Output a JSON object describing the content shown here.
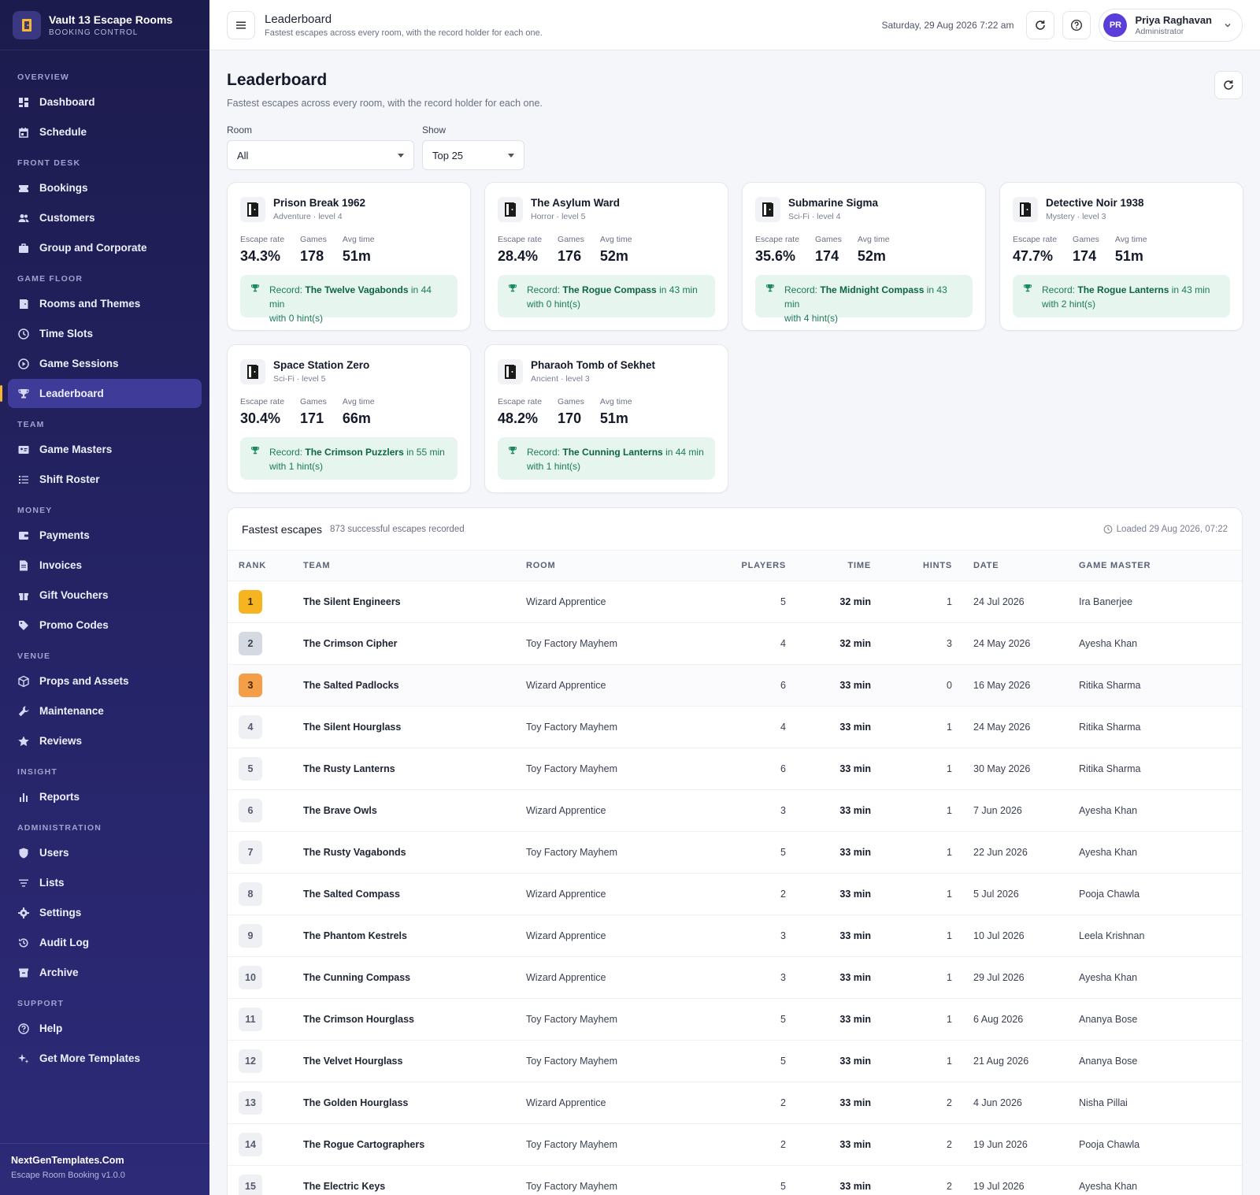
{
  "brand": {
    "name": "Vault 13 Escape Rooms",
    "sub": "BOOKING CONTROL"
  },
  "nav": [
    {
      "section": "OVERVIEW",
      "items": [
        {
          "label": "Dashboard",
          "icon": "dashboard-icon"
        },
        {
          "label": "Schedule",
          "icon": "calendar-icon"
        }
      ]
    },
    {
      "section": "FRONT DESK",
      "items": [
        {
          "label": "Bookings",
          "icon": "ticket-icon"
        },
        {
          "label": "Customers",
          "icon": "users-icon"
        },
        {
          "label": "Group and Corporate",
          "icon": "briefcase-icon"
        }
      ]
    },
    {
      "section": "GAME FLOOR",
      "items": [
        {
          "label": "Rooms and Themes",
          "icon": "door-icon"
        },
        {
          "label": "Time Slots",
          "icon": "clock-icon"
        },
        {
          "label": "Game Sessions",
          "icon": "play-icon"
        },
        {
          "label": "Leaderboard",
          "icon": "trophy-icon",
          "active": true
        }
      ]
    },
    {
      "section": "TEAM",
      "items": [
        {
          "label": "Game Masters",
          "icon": "id-card-icon"
        },
        {
          "label": "Shift Roster",
          "icon": "list-icon"
        }
      ]
    },
    {
      "section": "MONEY",
      "items": [
        {
          "label": "Payments",
          "icon": "wallet-icon"
        },
        {
          "label": "Invoices",
          "icon": "invoice-icon"
        },
        {
          "label": "Gift Vouchers",
          "icon": "gift-icon"
        },
        {
          "label": "Promo Codes",
          "icon": "tag-icon"
        }
      ]
    },
    {
      "section": "VENUE",
      "items": [
        {
          "label": "Props and Assets",
          "icon": "box-icon"
        },
        {
          "label": "Maintenance",
          "icon": "wrench-icon"
        },
        {
          "label": "Reviews",
          "icon": "star-icon"
        }
      ]
    },
    {
      "section": "INSIGHT",
      "items": [
        {
          "label": "Reports",
          "icon": "bar-chart-icon"
        }
      ]
    },
    {
      "section": "ADMINISTRATION",
      "items": [
        {
          "label": "Users",
          "icon": "shield-icon"
        },
        {
          "label": "Lists",
          "icon": "filter-icon"
        },
        {
          "label": "Settings",
          "icon": "gear-icon"
        },
        {
          "label": "Audit Log",
          "icon": "history-icon"
        },
        {
          "label": "Archive",
          "icon": "archive-icon"
        }
      ]
    },
    {
      "section": "SUPPORT",
      "items": [
        {
          "label": "Help",
          "icon": "help-icon"
        },
        {
          "label": "Get More Templates",
          "icon": "sparkle-icon"
        }
      ]
    }
  ],
  "footer": {
    "title": "NextGenTemplates.Com",
    "sub": "Escape Room Booking v1.0.0"
  },
  "topbar": {
    "title": "Leaderboard",
    "subtitle": "Fastest escapes across every room, with the record holder for each one.",
    "date": "Saturday, 29 Aug 2026 7:22 am",
    "user": {
      "initials": "PR",
      "name": "Priya Raghavan",
      "role": "Administrator"
    }
  },
  "page": {
    "title": "Leaderboard",
    "subtitle": "Fastest escapes across every room, with the record holder for each one.",
    "filters": {
      "room": {
        "label": "Room",
        "value": "All"
      },
      "show": {
        "label": "Show",
        "value": "Top 25"
      }
    }
  },
  "stat_labels": {
    "escape_rate": "Escape rate",
    "games": "Games",
    "avg_time": "Avg time",
    "record_prefix": "Record:",
    "in": "in",
    "with": "with"
  },
  "rooms": [
    {
      "name": "Prison Break 1962",
      "meta": "Adventure · level 4",
      "escape_rate": "34.3%",
      "games": "178",
      "avg_time": "51m",
      "record_team": "The Twelve Vagabonds",
      "record_time": "44 min",
      "record_hints": "0 hint(s)"
    },
    {
      "name": "The Asylum Ward",
      "meta": "Horror · level 5",
      "escape_rate": "28.4%",
      "games": "176",
      "avg_time": "52m",
      "record_team": "The Rogue Compass",
      "record_time": "43 min",
      "record_hints": "0 hint(s)"
    },
    {
      "name": "Submarine Sigma",
      "meta": "Sci-Fi · level 4",
      "escape_rate": "35.6%",
      "games": "174",
      "avg_time": "52m",
      "record_team": "The Midnight Compass",
      "record_time": "43 min",
      "record_hints": "4 hint(s)"
    },
    {
      "name": "Detective Noir 1938",
      "meta": "Mystery · level 3",
      "escape_rate": "47.7%",
      "games": "174",
      "avg_time": "51m",
      "record_team": "The Rogue Lanterns",
      "record_time": "43 min",
      "record_hints": "2 hint(s)"
    },
    {
      "name": "Space Station Zero",
      "meta": "Sci-Fi · level 5",
      "escape_rate": "30.4%",
      "games": "171",
      "avg_time": "66m",
      "record_team": "The Crimson Puzzlers",
      "record_time": "55 min",
      "record_hints": "1 hint(s)"
    },
    {
      "name": "Pharaoh Tomb of Sekhet",
      "meta": "Ancient · level 3",
      "escape_rate": "48.2%",
      "games": "170",
      "avg_time": "51m",
      "record_team": "The Cunning Lanterns",
      "record_time": "44 min",
      "record_hints": "1 hint(s)"
    }
  ],
  "table": {
    "title": "Fastest escapes",
    "count": "873 successful escapes recorded",
    "loaded": "Loaded 29 Aug 2026, 07:22",
    "columns": [
      "RANK",
      "TEAM",
      "ROOM",
      "PLAYERS",
      "TIME",
      "HINTS",
      "DATE",
      "GAME MASTER"
    ],
    "rows": [
      {
        "rank": "1",
        "team": "The Silent Engineers",
        "room": "Wizard Apprentice",
        "players": "5",
        "time": "32 min",
        "hints": "1",
        "date": "24 Jul 2026",
        "gm": "Ira Banerjee"
      },
      {
        "rank": "2",
        "team": "The Crimson Cipher",
        "room": "Toy Factory Mayhem",
        "players": "4",
        "time": "32 min",
        "hints": "3",
        "date": "24 May 2026",
        "gm": "Ayesha Khan"
      },
      {
        "rank": "3",
        "team": "The Salted Padlocks",
        "room": "Wizard Apprentice",
        "players": "6",
        "time": "33 min",
        "hints": "0",
        "date": "16 May 2026",
        "gm": "Ritika Sharma"
      },
      {
        "rank": "4",
        "team": "The Silent Hourglass",
        "room": "Toy Factory Mayhem",
        "players": "4",
        "time": "33 min",
        "hints": "1",
        "date": "24 May 2026",
        "gm": "Ritika Sharma"
      },
      {
        "rank": "5",
        "team": "The Rusty Lanterns",
        "room": "Toy Factory Mayhem",
        "players": "6",
        "time": "33 min",
        "hints": "1",
        "date": "30 May 2026",
        "gm": "Ritika Sharma"
      },
      {
        "rank": "6",
        "team": "The Brave Owls",
        "room": "Wizard Apprentice",
        "players": "3",
        "time": "33 min",
        "hints": "1",
        "date": "7 Jun 2026",
        "gm": "Ayesha Khan"
      },
      {
        "rank": "7",
        "team": "The Rusty Vagabonds",
        "room": "Toy Factory Mayhem",
        "players": "5",
        "time": "33 min",
        "hints": "1",
        "date": "22 Jun 2026",
        "gm": "Ayesha Khan"
      },
      {
        "rank": "8",
        "team": "The Salted Compass",
        "room": "Wizard Apprentice",
        "players": "2",
        "time": "33 min",
        "hints": "1",
        "date": "5 Jul 2026",
        "gm": "Pooja Chawla"
      },
      {
        "rank": "9",
        "team": "The Phantom Kestrels",
        "room": "Wizard Apprentice",
        "players": "3",
        "time": "33 min",
        "hints": "1",
        "date": "10 Jul 2026",
        "gm": "Leela Krishnan"
      },
      {
        "rank": "10",
        "team": "The Cunning Compass",
        "room": "Wizard Apprentice",
        "players": "3",
        "time": "33 min",
        "hints": "1",
        "date": "29 Jul 2026",
        "gm": "Ayesha Khan"
      },
      {
        "rank": "11",
        "team": "The Crimson Hourglass",
        "room": "Toy Factory Mayhem",
        "players": "5",
        "time": "33 min",
        "hints": "1",
        "date": "6 Aug 2026",
        "gm": "Ananya Bose"
      },
      {
        "rank": "12",
        "team": "The Velvet Hourglass",
        "room": "Toy Factory Mayhem",
        "players": "5",
        "time": "33 min",
        "hints": "1",
        "date": "21 Aug 2026",
        "gm": "Ananya Bose"
      },
      {
        "rank": "13",
        "team": "The Golden Hourglass",
        "room": "Wizard Apprentice",
        "players": "2",
        "time": "33 min",
        "hints": "2",
        "date": "4 Jun 2026",
        "gm": "Nisha Pillai"
      },
      {
        "rank": "14",
        "team": "The Rogue Cartographers",
        "room": "Toy Factory Mayhem",
        "players": "2",
        "time": "33 min",
        "hints": "2",
        "date": "19 Jun 2026",
        "gm": "Pooja Chawla"
      },
      {
        "rank": "15",
        "team": "The Electric Keys",
        "room": "Toy Factory Mayhem",
        "players": "5",
        "time": "33 min",
        "hints": "2",
        "date": "19 Jul 2026",
        "gm": "Ayesha Khan"
      }
    ]
  }
}
